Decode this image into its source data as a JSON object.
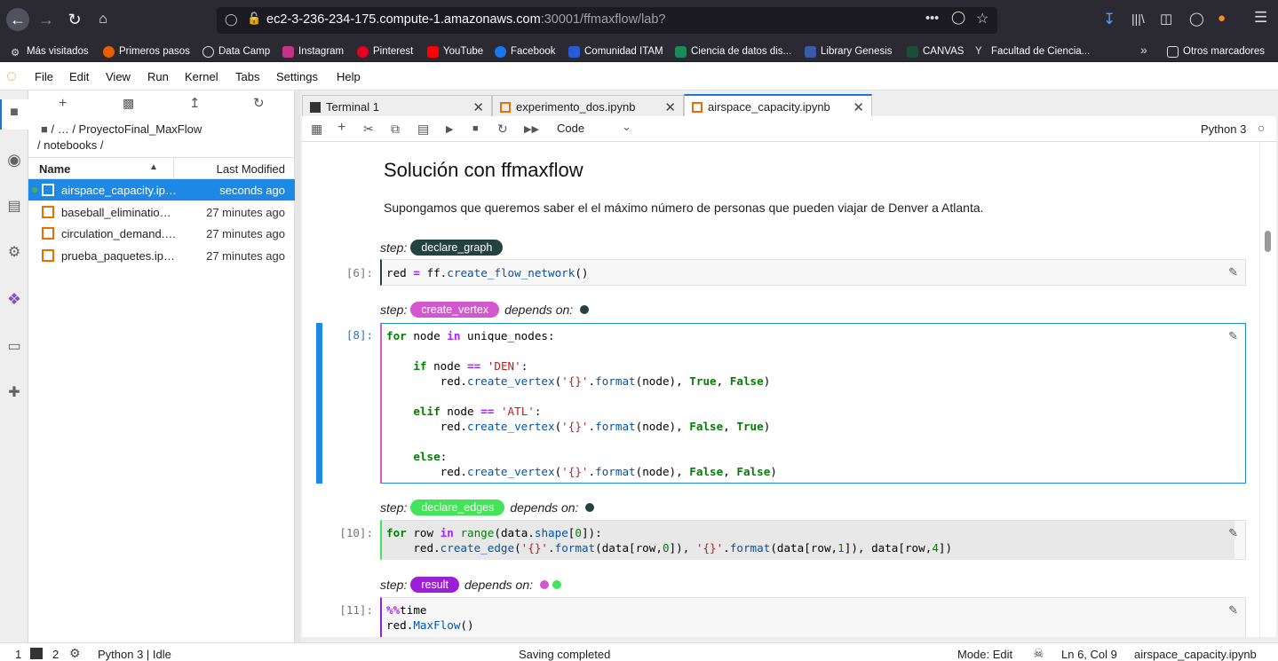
{
  "browser": {
    "url_host": "ec2-3-236-234-175.compute-1.amazonaws.com",
    "url_path": ":30001/ffmaxflow/lab?",
    "bookmarks": [
      "Más visitados",
      "Primeros pasos",
      "Data Camp",
      "Instagram",
      "Pinterest",
      "YouTube",
      "Facebook",
      "Comunidad ITAM",
      "Ciencia de datos dis...",
      "Library Genesis",
      "CANVAS",
      "Facultad de Ciencia...",
      "Otros marcadores"
    ]
  },
  "menu": [
    "File",
    "Edit",
    "View",
    "Run",
    "Kernel",
    "Tabs",
    "Settings",
    "Help"
  ],
  "filebrowser": {
    "breadcrumb_1": "/  …  / ProyectoFinal_MaxFlow",
    "breadcrumb_2": "/ notebooks /",
    "col_name": "Name",
    "col_modified": "Last Modified",
    "files": [
      {
        "name": "airspace_capacity.ipynb",
        "modified": "seconds ago"
      },
      {
        "name": "baseball_elimination.ipynb",
        "modified": "27 minutes ago"
      },
      {
        "name": "circulation_demand.ipynb",
        "modified": "27 minutes ago"
      },
      {
        "name": "prueba_paquetes.ipynb",
        "modified": "27 minutes ago"
      }
    ]
  },
  "tabs": [
    {
      "label": "Terminal 1"
    },
    {
      "label": "experimento_dos.ipynb"
    },
    {
      "label": "airspace_capacity.ipynb"
    }
  ],
  "toolbar": {
    "cell_type": "Code",
    "kernel": "Python 3"
  },
  "notebook": {
    "heading": "Solución con ffmaxflow",
    "paragraph": "Supongamos que queremos saber el el máximo número de personas que pueden viajar de Denver a Atlanta.",
    "step_word": "step:",
    "depends_word": "depends on:",
    "steps": [
      {
        "name": "declare_graph",
        "prompt": "[6]:",
        "color": "#24423e"
      },
      {
        "name": "create_vertex",
        "prompt": "[8]:",
        "color": "#d357cf"
      },
      {
        "name": "declare_edges",
        "prompt": "[10]:",
        "color": "#43e35a"
      },
      {
        "name": "result",
        "prompt": "[11]:",
        "color": "#9b1fd6"
      }
    ]
  },
  "status": {
    "left_1": "1",
    "left_2": "2",
    "kernel_state": "Python 3 | Idle",
    "center": "Saving completed",
    "mode": "Mode: Edit",
    "position": "Ln 6, Col 9",
    "filename": "airspace_capacity.ipynb"
  }
}
